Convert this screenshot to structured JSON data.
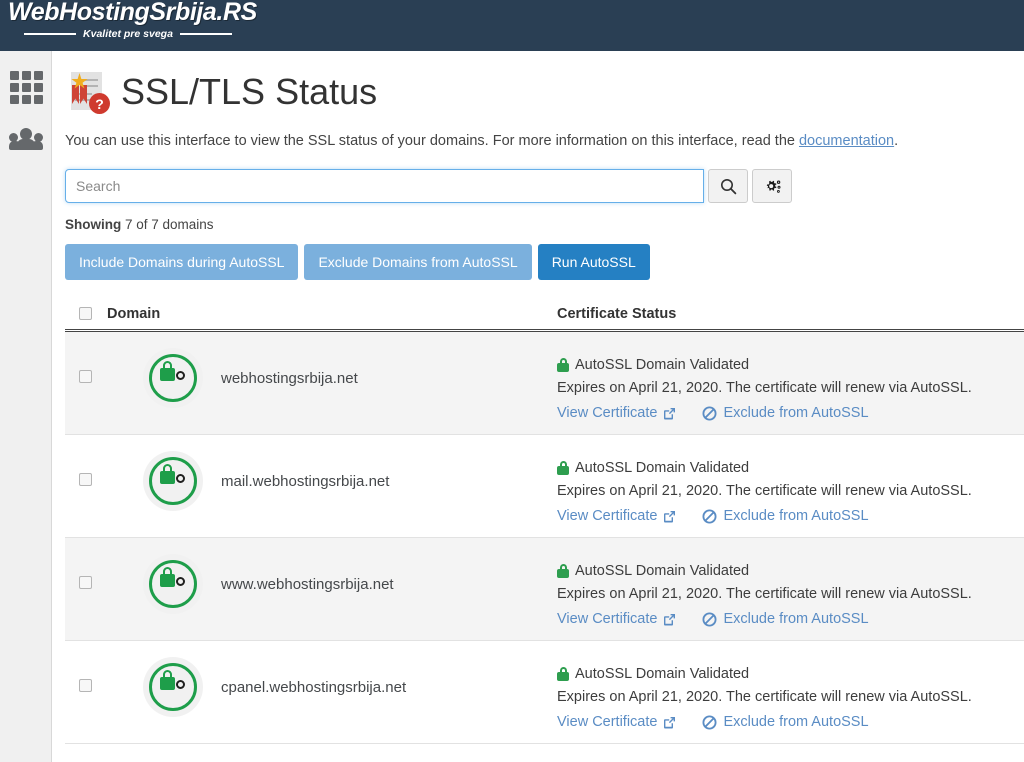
{
  "header": {
    "logo_text": "WebHostingSrbija.RS",
    "logo_tagline": "Kvalitet pre svega",
    "background_color": "#2a3f54"
  },
  "sidebar": {
    "items": [
      {
        "icon": "grid-icon",
        "name": "apps"
      },
      {
        "icon": "people-icon",
        "name": "users"
      }
    ]
  },
  "page": {
    "title": "SSL/TLS Status",
    "icon": "certificate-question-icon",
    "intro_before": "You can use this interface to view the SSL status of your domains. For more information on this interface, read the ",
    "intro_link": "documentation",
    "intro_after": "."
  },
  "search": {
    "value": "",
    "placeholder": "Search",
    "search_button_icon": "search-icon",
    "settings_button_icon": "cogs-icon"
  },
  "summary": {
    "label": "Showing",
    "text": " 7 of 7 domains"
  },
  "actions": {
    "include": "Include Domains during AutoSSL",
    "exclude": "Exclude Domains from AutoSSL",
    "run": "Run AutoSSL",
    "light_color": "#7bb0dd",
    "primary_color": "#2580c3"
  },
  "table": {
    "columns": {
      "select": "",
      "domain": "Domain",
      "status": "Certificate Status"
    },
    "rows": [
      {
        "domain": "webhostingsrbija.net",
        "icon": "lock-valid-icon",
        "status_title": "AutoSSL Domain Validated",
        "status_detail": "Expires on April 21, 2020. The certificate will renew via AutoSSL.",
        "view_link": "View Certificate",
        "exclude_link": "Exclude from AutoSSL"
      },
      {
        "domain": "mail.webhostingsrbija.net",
        "icon": "lock-valid-icon",
        "status_title": "AutoSSL Domain Validated",
        "status_detail": "Expires on April 21, 2020. The certificate will renew via AutoSSL.",
        "view_link": "View Certificate",
        "exclude_link": "Exclude from AutoSSL"
      },
      {
        "domain": "www.webhostingsrbija.net",
        "icon": "lock-valid-icon",
        "status_title": "AutoSSL Domain Validated",
        "status_detail": "Expires on April 21, 2020. The certificate will renew via AutoSSL.",
        "view_link": "View Certificate",
        "exclude_link": "Exclude from AutoSSL"
      },
      {
        "domain": "cpanel.webhostingsrbija.net",
        "icon": "lock-valid-icon",
        "status_title": "AutoSSL Domain Validated",
        "status_detail": "Expires on April 21, 2020. The certificate will renew via AutoSSL.",
        "view_link": "View Certificate",
        "exclude_link": "Exclude from AutoSSL"
      }
    ]
  }
}
